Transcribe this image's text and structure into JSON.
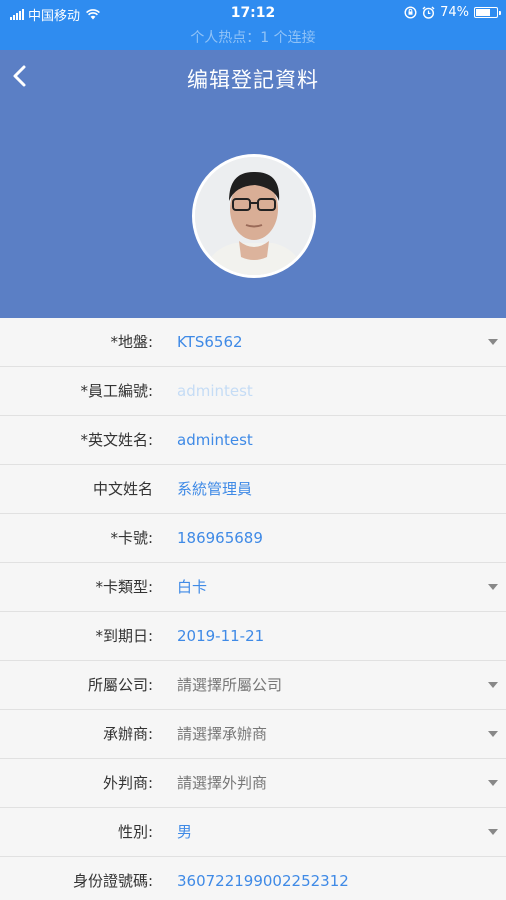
{
  "status_bar": {
    "carrier": "中国移动",
    "time": "17:12",
    "battery": "74%",
    "battery_level": 0.74,
    "hotspot": "个人热点：1 个连接"
  },
  "header": {
    "title": "编辑登記資料",
    "back_icon": "chevron-left-icon",
    "background": "#5b7fc5"
  },
  "form": {
    "rows": [
      {
        "label": "*地盤:",
        "value": "KTS6562",
        "dropdown": true,
        "style": "value"
      },
      {
        "label": "*員工編號:",
        "value": "admintest",
        "dropdown": false,
        "style": "faded"
      },
      {
        "label": "*英文姓名:",
        "value": "admintest",
        "dropdown": false,
        "style": "value"
      },
      {
        "label": "中文姓名",
        "value": "系統管理員",
        "dropdown": false,
        "style": "value"
      },
      {
        "label": "*卡號:",
        "value": "186965689",
        "dropdown": false,
        "style": "value"
      },
      {
        "label": "*卡類型:",
        "value": "白卡",
        "dropdown": true,
        "style": "value"
      },
      {
        "label": "*到期日:",
        "value": "2019-11-21",
        "dropdown": false,
        "style": "value"
      },
      {
        "label": "所屬公司:",
        "value": "請選擇所屬公司",
        "dropdown": true,
        "style": "placeholder"
      },
      {
        "label": "承辦商:",
        "value": "請選擇承辦商",
        "dropdown": true,
        "style": "placeholder"
      },
      {
        "label": "外判商:",
        "value": "請選擇外判商",
        "dropdown": true,
        "style": "placeholder"
      },
      {
        "label": "性別:",
        "value": "男",
        "dropdown": true,
        "style": "value"
      },
      {
        "label": "身份證號碼:",
        "value": "360722199002252312",
        "dropdown": false,
        "style": "value"
      }
    ]
  },
  "colors": {
    "status_bar": "#2f8cf0",
    "value_text": "#3f8ae6"
  }
}
